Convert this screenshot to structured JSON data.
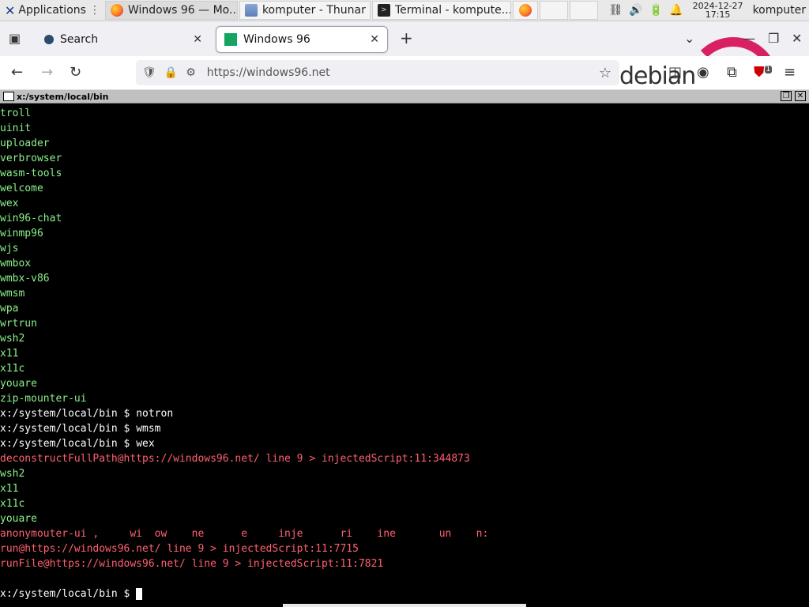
{
  "panel": {
    "apps_label": "Applications",
    "tasks": [
      {
        "label": "Windows 96 — Mo...",
        "icon": "firefox-icon"
      },
      {
        "label": "komputer - Thunar",
        "icon": "folder-icon"
      },
      {
        "label": "Terminal - kompute...",
        "icon": "terminal-icon"
      }
    ],
    "clock_date": "2024-12-27",
    "clock_time": "17:15",
    "user": "komputer"
  },
  "browser": {
    "tabs": [
      {
        "label": "Search"
      },
      {
        "label": "Windows 96"
      }
    ],
    "url": "https://windows96.net",
    "brand_word": "debian",
    "extension_badge": "1"
  },
  "window": {
    "title": "x:/system/local/bin"
  },
  "terminal": {
    "prompt": "x:/system/local/bin $ ",
    "lines": [
      {
        "text": "troll",
        "kind": "g"
      },
      {
        "text": "uinit",
        "kind": "g"
      },
      {
        "text": "uploader",
        "kind": "g"
      },
      {
        "text": "verbrowser",
        "kind": "g"
      },
      {
        "text": "wasm-tools",
        "kind": "g"
      },
      {
        "text": "welcome",
        "kind": "g"
      },
      {
        "text": "wex",
        "kind": "g"
      },
      {
        "text": "win96-chat",
        "kind": "g"
      },
      {
        "text": "winmp96",
        "kind": "g"
      },
      {
        "text": "wjs",
        "kind": "g"
      },
      {
        "text": "wmbox",
        "kind": "g"
      },
      {
        "text": "wmbx-v86",
        "kind": "g"
      },
      {
        "text": "wmsm",
        "kind": "g"
      },
      {
        "text": "wpa",
        "kind": "g"
      },
      {
        "text": "wrtrun",
        "kind": "g"
      },
      {
        "text": "wsh2",
        "kind": "g"
      },
      {
        "text": "x11",
        "kind": "g"
      },
      {
        "text": "x11c",
        "kind": "g"
      },
      {
        "text": "youare",
        "kind": "g"
      },
      {
        "text": "zip-mounter-ui",
        "kind": "g"
      },
      {
        "text": "notron",
        "kind": "cmd"
      },
      {
        "text": "wmsm",
        "kind": "cmd"
      },
      {
        "text": "wex",
        "kind": "cmd"
      },
      {
        "text": "deconstructFullPath@https://windows96.net/ line 9 > injectedScript:11:344873",
        "kind": "r"
      },
      {
        "text": "wsh2",
        "kind": "g"
      },
      {
        "text": "x11",
        "kind": "g"
      },
      {
        "text": "x11c",
        "kind": "g"
      },
      {
        "text": "youare",
        "kind": "g"
      },
      {
        "text": "anonymouter-ui ,     wi  ow    ne      e     inje      ri    ine       un    n:",
        "kind": "r"
      },
      {
        "text": "run@https://windows96.net/ line 9 > injectedScript:11:7715",
        "kind": "r"
      },
      {
        "text": "runFile@https://windows96.net/ line 9 > injectedScript:11:7821",
        "kind": "r"
      },
      {
        "text": "",
        "kind": "g"
      },
      {
        "text": "",
        "kind": "prompt"
      }
    ]
  }
}
